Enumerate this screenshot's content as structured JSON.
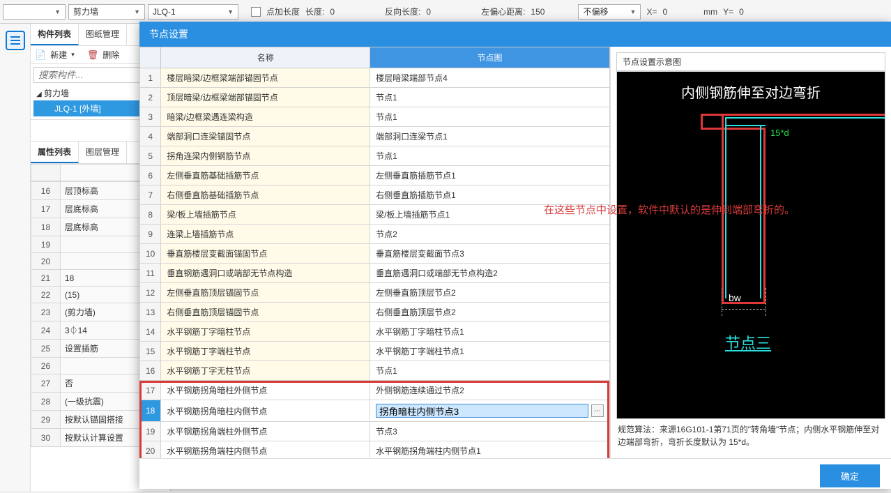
{
  "toolbar": {
    "dropdown1": "",
    "dropdown2": "剪力墙",
    "dropdown3": "JLQ-1",
    "check_label": "点加长度",
    "len_label": "长度:",
    "len_val": "0",
    "rev_len_label": "反向长度:",
    "rev_len_val": "0",
    "left_off_label": "左偏心距离:",
    "left_off_val": "150",
    "offset_dd": "不偏移",
    "x_label": "X=",
    "x_val": "0",
    "mm_label": "mm",
    "y_label": "Y=",
    "y_val": "0"
  },
  "left": {
    "tab1": "构件列表",
    "tab2": "图纸管理",
    "new_btn": "新建",
    "del_btn": "删除",
    "search_ph": "搜索构件...",
    "tree_root": "剪力墙",
    "tree_child": "JLQ-1 [外墙]",
    "prop_tab1": "属性列表",
    "prop_tab2": "图层管理"
  },
  "props": [
    {
      "n": "16",
      "name": "层顶标高"
    },
    {
      "n": "17",
      "name": "层底标高"
    },
    {
      "n": "18",
      "name": "层底标高"
    },
    {
      "n": "19",
      "name": ""
    },
    {
      "n": "20",
      "name": ""
    },
    {
      "n": "21",
      "name": "18"
    },
    {
      "n": "22",
      "name": "(15)"
    },
    {
      "n": "23",
      "name": "(剪力墙)"
    },
    {
      "n": "24",
      "name": "3⏀14"
    },
    {
      "n": "25",
      "name": "设置插筋"
    },
    {
      "n": "26",
      "name": ""
    },
    {
      "n": "27",
      "name": "否"
    },
    {
      "n": "28",
      "name": "(一级抗震)"
    },
    {
      "n": "29",
      "name": "按默认锚固搭接"
    },
    {
      "n": "30",
      "name": "按默认计算设置"
    }
  ],
  "dialog": {
    "title": "节点设置",
    "col_name": "名称",
    "col_node": "节点图",
    "diag_title": "节点设置示意图",
    "diag_heading": "内侧钢筋伸至对边弯折",
    "dim1": "15*d",
    "bw": "bw",
    "node3": "节点三",
    "caption": "规范算法：来源16G101-1第71页的\"转角墙\"节点；内侧水平钢筋伸至对边端部弯折，弯折长度默认为 15*d。",
    "ok": "确定",
    "anno": "在这些节点中设置，软件中默认的是伸到端部弯折的。"
  },
  "rows": [
    {
      "n": "1",
      "name": "楼层暗梁/边框梁端部锚固节点",
      "val": "楼层暗梁端部节点4"
    },
    {
      "n": "2",
      "name": "顶层暗梁/边框梁端部锚固节点",
      "val": "节点1"
    },
    {
      "n": "3",
      "name": "暗梁/边框梁遇连梁构造",
      "val": "节点1"
    },
    {
      "n": "4",
      "name": "端部洞口连梁锚固节点",
      "val": "端部洞口连梁节点1"
    },
    {
      "n": "5",
      "name": "拐角连梁内侧钢筋节点",
      "val": "节点1"
    },
    {
      "n": "6",
      "name": "左侧垂直筋基础插筋节点",
      "val": "左侧垂直筋插筋节点1"
    },
    {
      "n": "7",
      "name": "右侧垂直筋基础插筋节点",
      "val": "右侧垂直筋插筋节点1"
    },
    {
      "n": "8",
      "name": "梁/板上墙插筋节点",
      "val": "梁/板上墙插筋节点1"
    },
    {
      "n": "9",
      "name": "连梁上墙插筋节点",
      "val": "节点2"
    },
    {
      "n": "10",
      "name": "垂直筋楼层变截面锚固节点",
      "val": "垂直筋楼层变截面节点3"
    },
    {
      "n": "11",
      "name": "垂直钢筋遇洞口或端部无节点构造",
      "val": "垂直筋遇洞口或端部无节点构造2"
    },
    {
      "n": "12",
      "name": "左侧垂直筋顶层锚固节点",
      "val": "左侧垂直筋顶层节点2"
    },
    {
      "n": "13",
      "name": "右侧垂直筋顶层锚固节点",
      "val": "右侧垂直筋顶层节点2"
    },
    {
      "n": "14",
      "name": "水平钢筋丁字暗柱节点",
      "val": "水平钢筋丁字暗柱节点1"
    },
    {
      "n": "15",
      "name": "水平钢筋丁字端柱节点",
      "val": "水平钢筋丁字端柱节点1"
    },
    {
      "n": "16",
      "name": "水平钢筋丁字无柱节点",
      "val": "节点1"
    },
    {
      "n": "17",
      "name": "水平钢筋拐角暗柱外侧节点",
      "val": "外侧钢筋连续通过节点2"
    },
    {
      "n": "18",
      "name": "水平钢筋拐角暗柱内侧节点",
      "val": "拐角暗柱内侧节点3"
    },
    {
      "n": "19",
      "name": "水平钢筋拐角端柱外侧节点",
      "val": "节点3"
    },
    {
      "n": "20",
      "name": "水平钢筋拐角端柱内侧节点",
      "val": "水平钢筋拐角端柱内侧节点1"
    }
  ]
}
